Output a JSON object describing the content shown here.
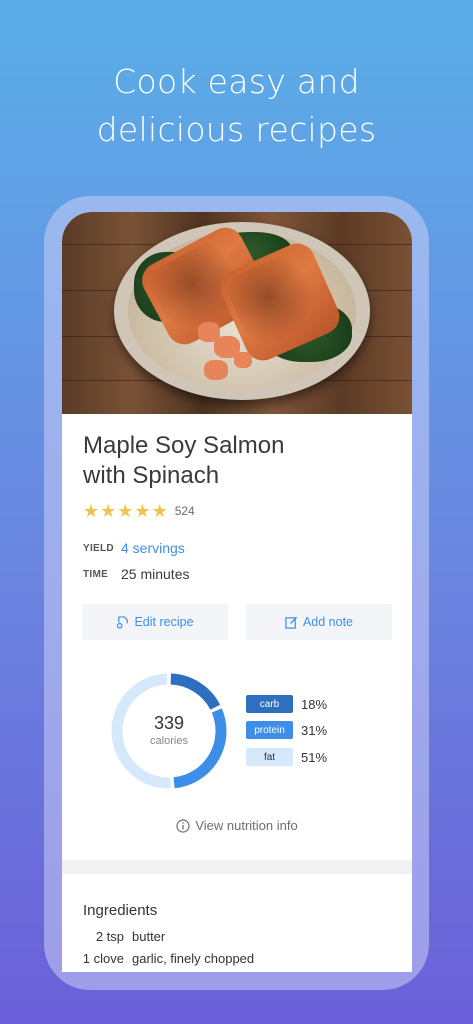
{
  "promo": {
    "line1": "Cook easy and",
    "line2": "delicious recipes"
  },
  "recipe": {
    "title_line1": "Maple Soy Salmon",
    "title_line2": "with Spinach",
    "rating_stars": 5,
    "rating_count": "524",
    "yield_label": "YIELD",
    "yield_value": "4 servings",
    "time_label": "TIME",
    "time_value": "25 minutes"
  },
  "actions": {
    "edit_label": "Edit recipe",
    "note_label": "Add note"
  },
  "nutrition": {
    "calories": "339",
    "calories_label": "calories",
    "macros": [
      {
        "name": "carb",
        "percent": "18%",
        "value": 18,
        "color": "#2f6fbf",
        "text_color": "#ffffff"
      },
      {
        "name": "protein",
        "percent": "31%",
        "value": 31,
        "color": "#3d8ee8",
        "text_color": "#ffffff"
      },
      {
        "name": "fat",
        "percent": "51%",
        "value": 51,
        "color": "#d6e8fb",
        "text_color": "#333333"
      }
    ],
    "link_label": "View nutrition info"
  },
  "ingredients": {
    "title": "Ingredients",
    "items": [
      {
        "qty": "2 tsp",
        "name": "butter"
      },
      {
        "qty": "1 clove",
        "name": "garlic, finely chopped"
      }
    ]
  },
  "colors": {
    "accent": "#3d8ee8",
    "star": "#f2c14e"
  }
}
